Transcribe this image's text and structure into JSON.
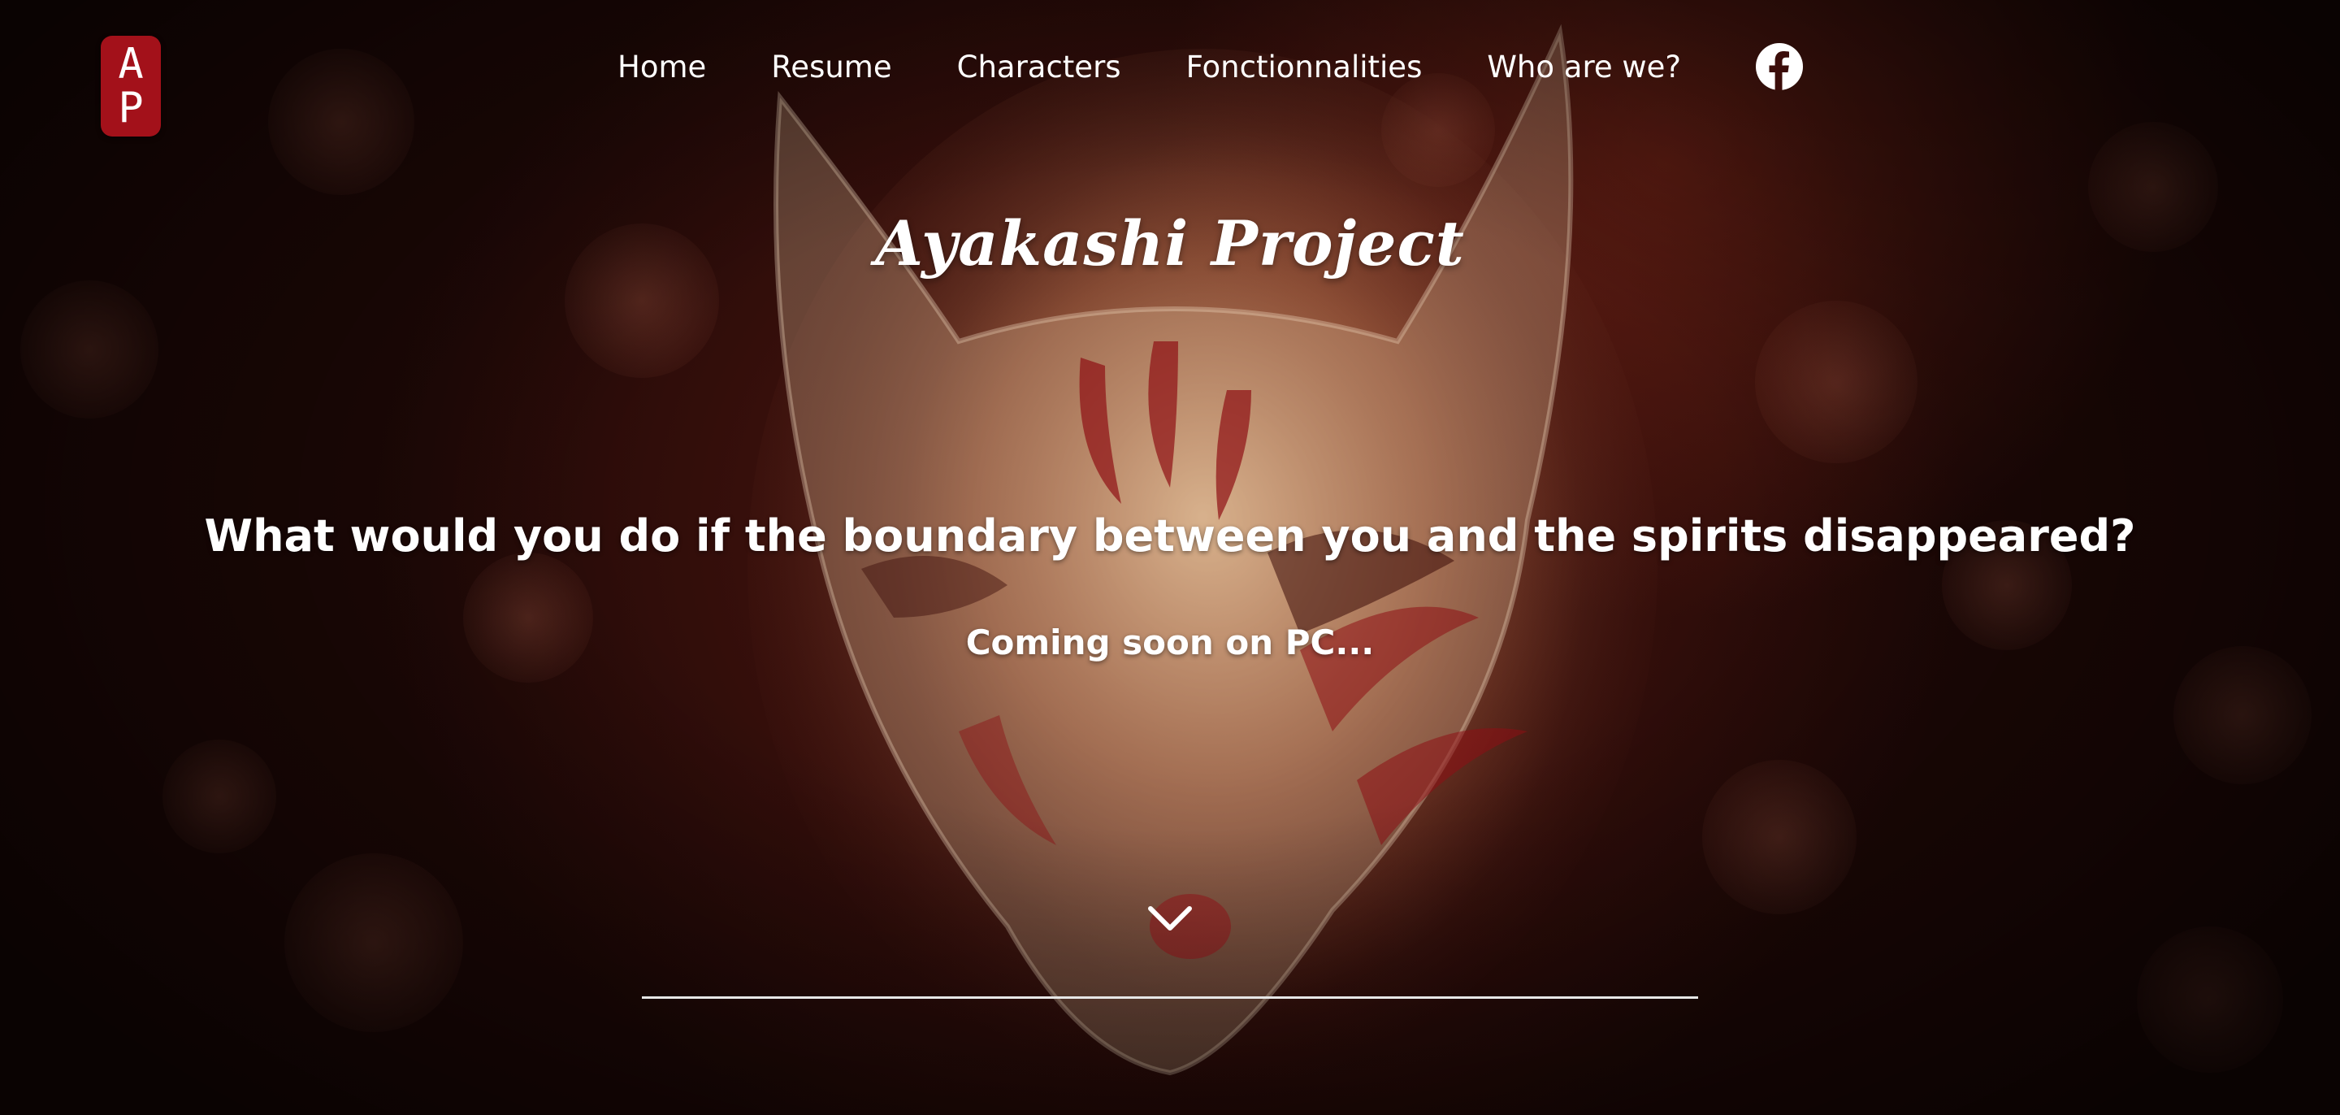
{
  "header": {
    "logo_text": [
      "A",
      "P"
    ],
    "nav": [
      {
        "label": "Home"
      },
      {
        "label": "Resume"
      },
      {
        "label": "Characters"
      },
      {
        "label": "Fonctionnalities"
      },
      {
        "label": "Who are we?"
      }
    ],
    "social_icon": "facebook-icon"
  },
  "hero": {
    "title": "Ayakashi Project",
    "tagline": "What would you do if the boundary between you and the spirits disappeared?",
    "release": "Coming soon on PC...",
    "scroll_icon": "chevron-down-icon"
  },
  "colors": {
    "logo_bg": "#a3111a",
    "text": "#ffffff",
    "background": "#1e0806"
  }
}
